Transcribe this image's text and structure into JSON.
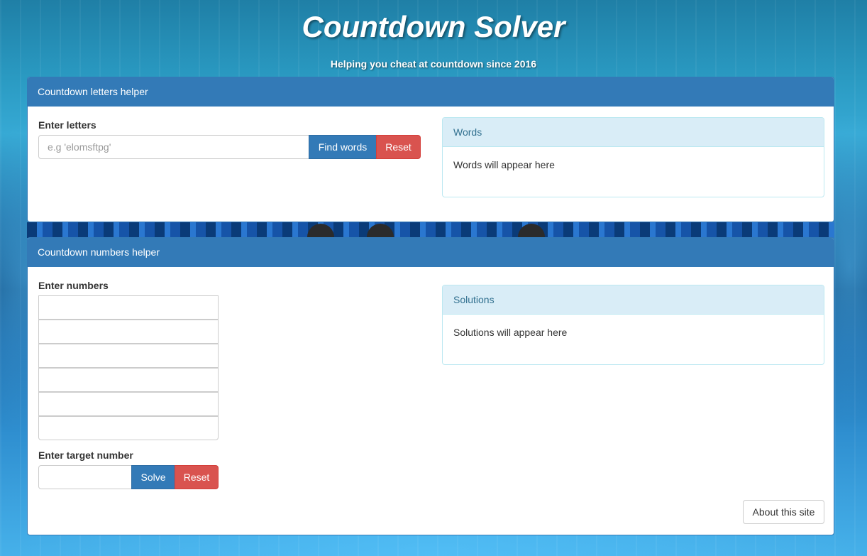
{
  "header": {
    "title": "Countdown Solver",
    "tagline": "Helping you cheat at countdown since 2016"
  },
  "letters": {
    "heading": "Countdown letters helper",
    "label": "Enter letters",
    "placeholder": "e.g 'elomsftpg'",
    "find_label": "Find words",
    "reset_label": "Reset",
    "results_heading": "Words",
    "results_text": "Words will appear here"
  },
  "numbers": {
    "heading": "Countdown numbers helper",
    "label": "Enter numbers",
    "target_label": "Enter target number",
    "solve_label": "Solve",
    "reset_label": "Reset",
    "results_heading": "Solutions",
    "results_text": "Solutions will appear here",
    "about_label": "About this site"
  },
  "colors": {
    "primary": "#337ab7",
    "danger": "#d9534f",
    "info_bg": "#d9edf7",
    "info_text": "#31708f"
  }
}
